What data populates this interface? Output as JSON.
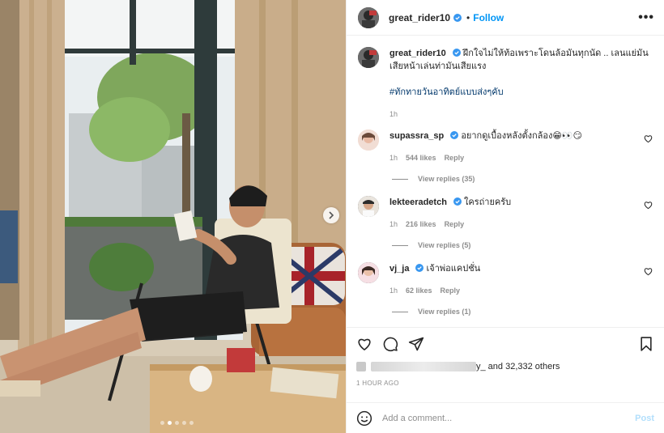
{
  "post": {
    "author": "great_rider10",
    "follow_label": "Follow",
    "bullet": "•",
    "more_label": "•••",
    "caption": "ฝึกใจไม่ให้ท้อเพราะโดนล้อมันทุกนัด .. เลนแย่มันเสียหน้าเล่นท่ามันเสียแรง",
    "hashtag": "#ทักทายวันอาทิตย์แบบส่งๆคับ",
    "caption_time": "1h",
    "likes_suffix": "y_ and 32,332 others",
    "posted_ago": "1 HOUR AGO",
    "comment_placeholder": "Add a comment...",
    "post_label": "Post",
    "photo_slide": 2,
    "photo_slide_count": 5
  },
  "comments": [
    {
      "user": "supassra_sp",
      "text": "อยากดูเบื้องหลังตั้งกล้อง😁👀😏",
      "time": "1h",
      "likes": "544 likes",
      "reply_label": "Reply",
      "view_replies": "View replies (35)"
    },
    {
      "user": "lekteeradetch",
      "text": "ใครถ่ายครับ",
      "time": "1h",
      "likes": "216 likes",
      "reply_label": "Reply",
      "view_replies": "View replies (5)"
    },
    {
      "user": "vj_ja",
      "text": "เจ้าพ่อแคปชั่น",
      "time": "1h",
      "likes": "62 likes",
      "reply_label": "Reply",
      "view_replies": "View replies (1)"
    }
  ],
  "colors": {
    "accent": "#0095f6",
    "verified": "#3897f0",
    "muted": "#8e8e8e"
  }
}
